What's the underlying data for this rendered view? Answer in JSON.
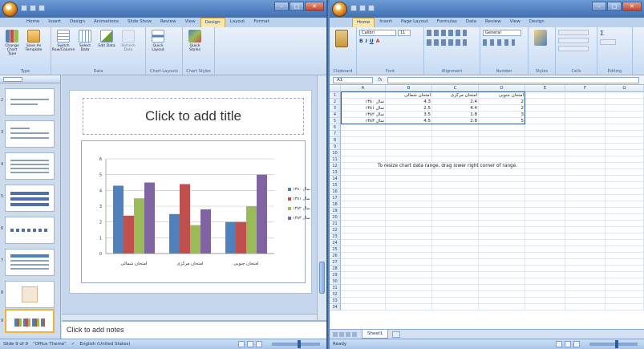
{
  "ppt": {
    "tabs": [
      "Home",
      "Insert",
      "Design",
      "Animations",
      "Slide Show",
      "Review",
      "View",
      "Design",
      "Layout",
      "Format"
    ],
    "active_tab_index": 7,
    "ribbon_groups": [
      {
        "label": "Type",
        "buttons": [
          "Change Chart Type",
          "Save As Template"
        ]
      },
      {
        "label": "Data",
        "buttons": [
          "Switch Row/Column",
          "Select Data",
          "Edit Data",
          "Refresh Data"
        ]
      },
      {
        "label": "Chart Layouts",
        "buttons": [
          "Quick Layout"
        ]
      },
      {
        "label": "Chart Styles",
        "buttons": [
          "Quick Styles"
        ]
      }
    ],
    "slide_title_placeholder": "Click to add title",
    "notes_placeholder": "Click to add notes",
    "status": [
      "Slide 9 of 9",
      "\"Office Theme\"",
      "English (United States)"
    ],
    "thumbnail_numbers": [
      "2",
      "3",
      "4",
      "5",
      "6",
      "7",
      "8",
      "9"
    ]
  },
  "chart_data": {
    "type": "bar",
    "categories": [
      "امتحان شمالی",
      "امتحان مرکزی",
      "امتحان جنوبی"
    ],
    "series": [
      {
        "name": "سال ۱۳۸۰",
        "color": "#4f81bd",
        "values": [
          4.3,
          2.5,
          2.0
        ]
      },
      {
        "name": "سال ۱۳۸۱",
        "color": "#c0504d",
        "values": [
          2.4,
          4.4,
          2.0
        ]
      },
      {
        "name": "سال ۱۳۸۲",
        "color": "#9bbb59",
        "values": [
          3.5,
          1.8,
          3.0
        ]
      },
      {
        "name": "سال ۱۳۸۳",
        "color": "#8064a2",
        "values": [
          4.5,
          2.8,
          5.0
        ]
      }
    ],
    "ylim": [
      0,
      6
    ],
    "yticks": [
      "0",
      "1",
      "2",
      "3",
      "4",
      "5",
      "6"
    ],
    "grid": true,
    "legend": "right"
  },
  "excel": {
    "tabs": [
      "Home",
      "Insert",
      "Page Layout",
      "Formulas",
      "Data",
      "Review",
      "View",
      "Design"
    ],
    "active_tab_index": 0,
    "ribbon_groups": [
      "Clipboard",
      "Font",
      "Alignment",
      "Number",
      "Styles",
      "Cells",
      "Editing"
    ],
    "font_name": "Calibri",
    "font_size": "11",
    "number_format": "General",
    "name_box": "A1",
    "formula_symbol": "fx",
    "columns": [
      "A",
      "B",
      "C",
      "D",
      "E",
      "F",
      "G"
    ],
    "rows": [
      "1",
      "2",
      "3",
      "4",
      "5",
      "6",
      "7",
      "8",
      "9",
      "10",
      "11",
      "12",
      "13",
      "14",
      "15",
      "16",
      "17",
      "18",
      "19",
      "20",
      "21",
      "22",
      "23",
      "24",
      "25",
      "26",
      "27",
      "28",
      "29",
      "30",
      "31",
      "32",
      "33",
      "34"
    ],
    "headers": [
      "امتحان شمالی",
      "امتحان مرکزی",
      "امتحان جنوبی"
    ],
    "data_rows": [
      {
        "label": "سال ۱۳۸۰",
        "values": [
          "4.3",
          "2.4",
          "2"
        ]
      },
      {
        "label": "سال ۱۳۸۱",
        "values": [
          "2.5",
          "4.4",
          "2"
        ]
      },
      {
        "label": "سال ۱۳۸۲",
        "values": [
          "3.5",
          "1.8",
          "3"
        ]
      },
      {
        "label": "سال ۱۳۸۳",
        "values": [
          "4.5",
          "2.8",
          "5"
        ]
      }
    ],
    "instruction": "To resize chart data range, drag lower right corner of range.",
    "sheet_tab": "Sheet1",
    "status": "Ready"
  }
}
